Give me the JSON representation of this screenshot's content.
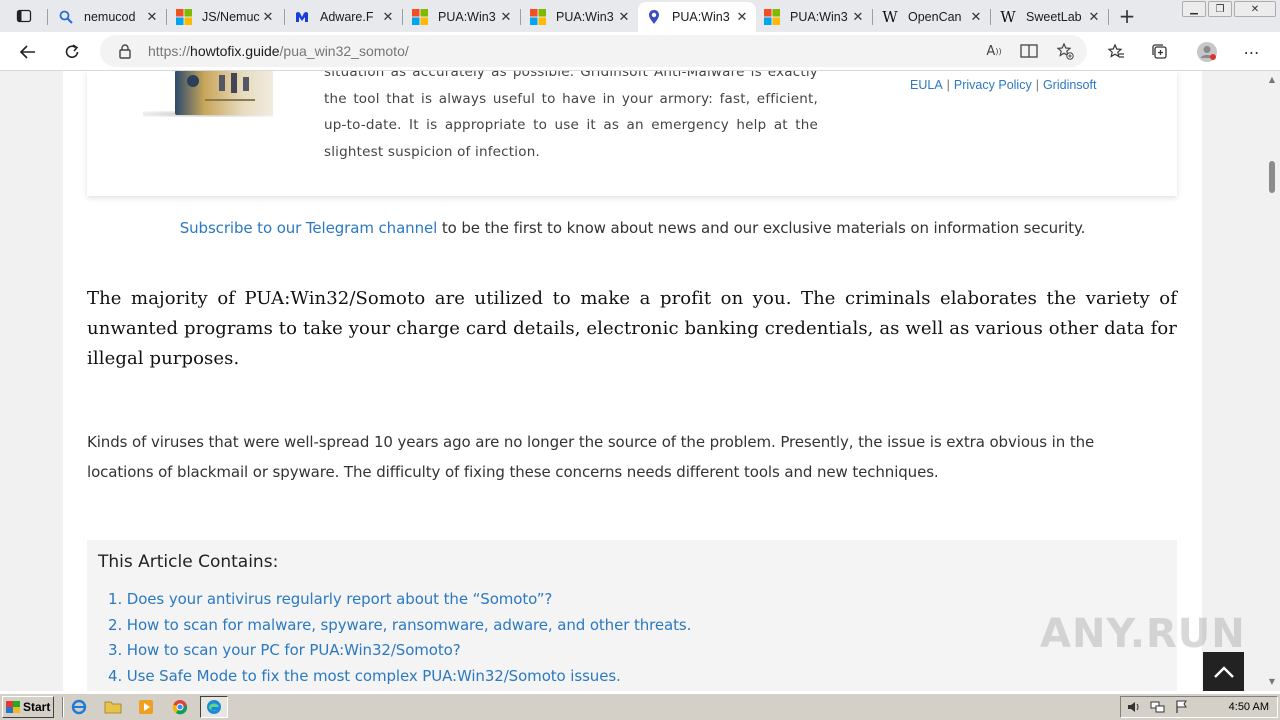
{
  "browser": {
    "tabs": [
      {
        "title": "nemucod",
        "icon": "search-icon",
        "active": false
      },
      {
        "title": "JS/Nemuc",
        "icon": "windows-logo-icon",
        "active": false
      },
      {
        "title": "Adware.F",
        "icon": "malwarebytes-icon",
        "active": false
      },
      {
        "title": "PUA:Win3",
        "icon": "windows-logo-icon",
        "active": false
      },
      {
        "title": "PUA:Win3",
        "icon": "windows-logo-icon",
        "active": false
      },
      {
        "title": "PUA:Win3",
        "icon": "shield-pin-icon",
        "active": true
      },
      {
        "title": "PUA:Win3",
        "icon": "windows-logo-icon",
        "active": false
      },
      {
        "title": "OpenCan",
        "icon": "wikipedia-icon",
        "active": false
      },
      {
        "title": "SweetLab",
        "icon": "wikipedia-icon",
        "active": false
      }
    ],
    "url_prefix": "https://",
    "url_host": "howtofix.guide",
    "url_path": "/pua_win32_somoto/"
  },
  "page": {
    "promo": {
      "text": "situation as accurately as possible. Gridinsoft Anti-Malware is exactly the tool that is always useful to have in your armory: fast, efficient, up-to-date. It is appropriate to use it as an emergency help at the slightest suspicion of infection.",
      "links": [
        "EULA",
        "Privacy Policy",
        "Gridinsoft"
      ]
    },
    "subscribe": {
      "link": "Subscribe to our Telegram channel",
      "rest": " to be the first to know about news and our exclusive materials on information security."
    },
    "lead": "The majority of PUA:Win32/Somoto are utilized to make a profit on you. The criminals elaborates the variety of unwanted programs to take your charge card details, electronic banking credentials, as well as various other data for illegal purposes.",
    "paragraph": "Kinds of viruses that were well-spread 10 years ago are no longer the source of the problem. Presently, the issue is extra obvious in the locations of blackmail or spyware. The difficulty of fixing these concerns needs different tools and new techniques.",
    "toc": {
      "title": "This Article Contains:",
      "items": [
        "1. Does your antivirus regularly report about the “Somoto”?",
        "2. How to scan for malware, spyware, ransomware, adware, and other threats.",
        "3. How to scan your PC for PUA:Win32/Somoto?",
        "4. Use Safe Mode to fix the most complex PUA:Win32/Somoto issues."
      ]
    },
    "watermark": "ANY.RUN"
  },
  "taskbar": {
    "start_label": "Start",
    "clock": "4:50 AM"
  },
  "colors": {
    "link": "#2b79c2",
    "tab_strip": "#e7e9ec",
    "taskbar": "#d4d0c8"
  }
}
